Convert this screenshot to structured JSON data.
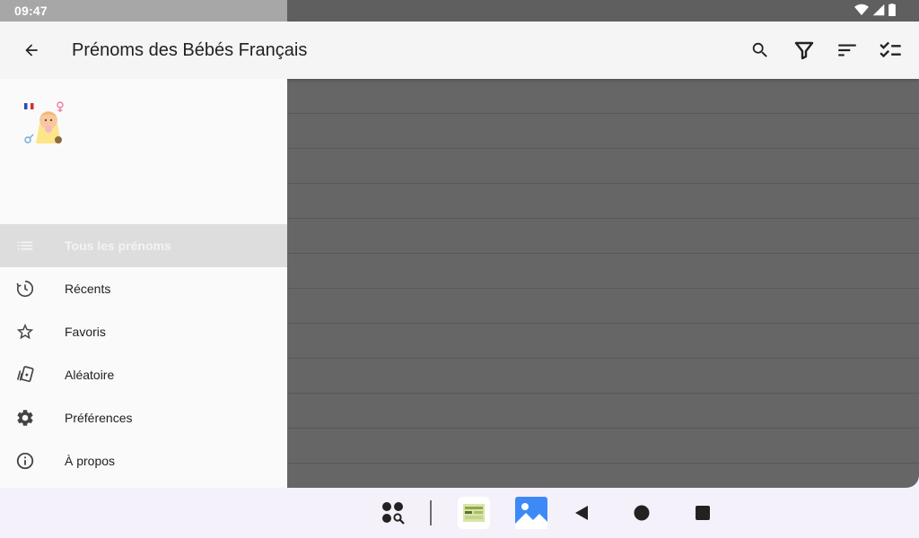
{
  "status_bar": {
    "time": "09:47",
    "icons": [
      "wifi-icon",
      "signal-icon",
      "battery-icon"
    ]
  },
  "app_bar": {
    "title": "Prénoms des Bébés Français",
    "actions": [
      "search-icon",
      "filter-icon",
      "sort-icon",
      "checklist-icon"
    ]
  },
  "drawer": {
    "items": [
      {
        "label": "Tous les prénoms",
        "icon": "list-icon",
        "active": true
      },
      {
        "label": "Récents",
        "icon": "history-icon",
        "active": false
      },
      {
        "label": "Favoris",
        "icon": "star-icon",
        "active": false
      },
      {
        "label": "Aléatoire",
        "icon": "cards-icon",
        "active": false
      },
      {
        "label": "Préférences",
        "icon": "gear-icon",
        "active": false
      },
      {
        "label": "À propos",
        "icon": "info-icon",
        "active": false
      }
    ]
  },
  "nav_bar": {
    "items": [
      "app-drawer-search-icon",
      "app-shortcut-icon",
      "gallery-icon",
      "back-icon",
      "home-icon",
      "recents-icon"
    ]
  },
  "colors": {
    "app_bar": "#f5f5f5",
    "scrim": "#5f5f5f",
    "drawer": "#fafafa",
    "active_item": "#dddddd"
  }
}
